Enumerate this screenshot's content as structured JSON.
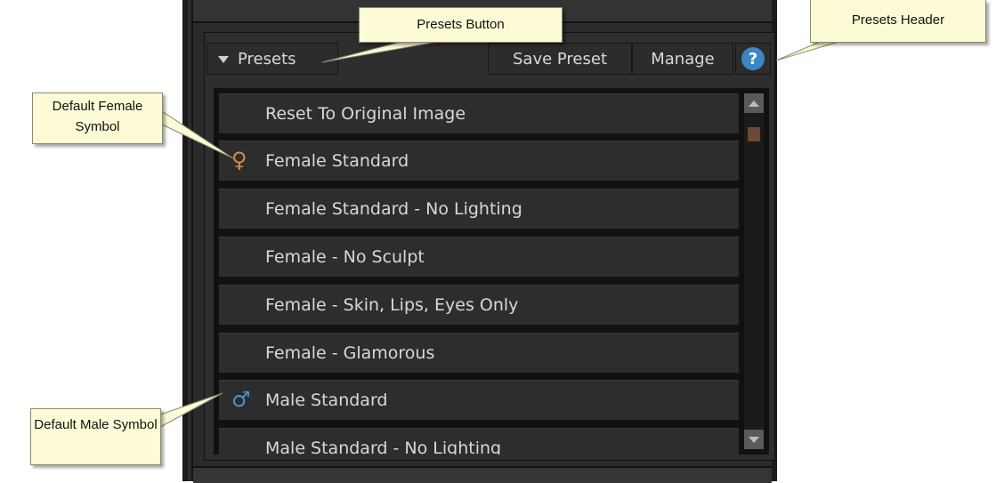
{
  "header": {
    "presets_label": "Presets",
    "save_label": "Save Preset",
    "manage_label": "Manage",
    "help_label": "?"
  },
  "presets": [
    {
      "label": "Reset To Original Image",
      "symbol": ""
    },
    {
      "label": "Female Standard",
      "symbol": "female"
    },
    {
      "label": "Female Standard - No Lighting",
      "symbol": ""
    },
    {
      "label": "Female - No Sculpt",
      "symbol": ""
    },
    {
      "label": "Female - Skin, Lips, Eyes Only",
      "symbol": ""
    },
    {
      "label": "Female - Glamorous",
      "symbol": ""
    },
    {
      "label": "Male Standard",
      "symbol": "male"
    },
    {
      "label": "Male Standard - No Lighting",
      "symbol": ""
    }
  ],
  "symbols": {
    "female": "♀",
    "male": "♂"
  },
  "callouts": {
    "presets_button": "Presets Button",
    "presets_header": "Presets Header",
    "default_female": "Default Female Symbol",
    "default_male": "Default Male Symbol"
  },
  "colors": {
    "female_symbol": "#d48a4a",
    "male_symbol": "#4b8fd2",
    "help_icon": "#3b86c4",
    "callout_bg": "#fdfbd5"
  }
}
